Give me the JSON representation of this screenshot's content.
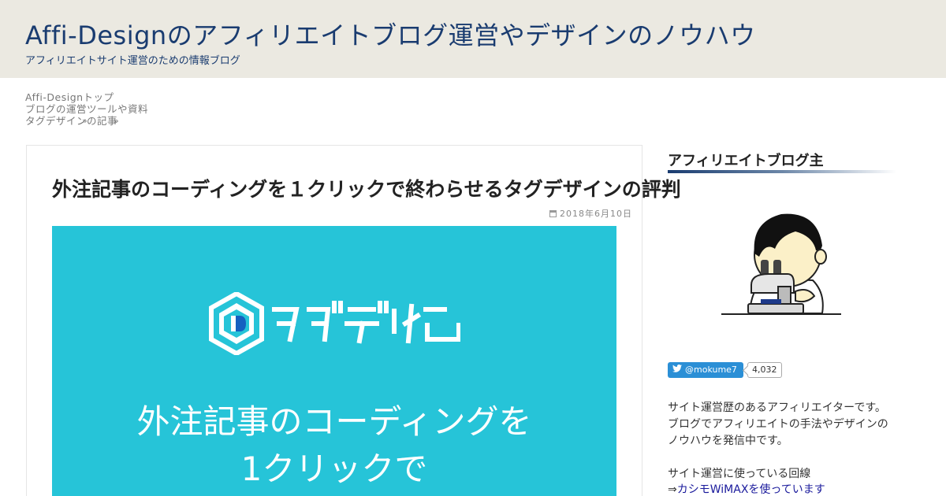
{
  "header": {
    "site_title": "Affi-Designのアフィリエイトブログ運営やデザインのノウハウ",
    "site_description": "アフィリエイトサイト運営のための情報ブログ"
  },
  "breadcrumb": {
    "items": [
      "Affi-Designトップ",
      "ブログの運営ツールや資料",
      "タグデザインの記事"
    ],
    "separators": [
      "»",
      "»"
    ]
  },
  "article": {
    "title": "外注記事のコーディングを１クリックで終わらせるタグデザインの評判",
    "date": "2018年6月10日",
    "date_icon": "calendar-icon",
    "eyecatch": {
      "logo_text": "タグデザイン",
      "line1": "外注記事のコーディングを",
      "line2": "1クリックで",
      "background": "#26c4d8"
    }
  },
  "sidebar": {
    "widget_title": "アフィリエイトブログ主",
    "avatar_icon": "researcher-microscope-icon",
    "twitter": {
      "handle": "@mokume7",
      "followers": "4,032",
      "icon": "twitter-bird-icon"
    },
    "profile_text": "サイト運営歴のあるアフィリエイターです。ブログでアフィリエイトの手法やデザインのノウハウを発信中です。",
    "profile_sub": "サイト運営に使っている回線",
    "profile_link_prefix": "⇒",
    "profile_link_text": "カシモWiMAXを使っています"
  },
  "colors": {
    "header_bg": "#ebe9e1",
    "brand": "#1a3c70",
    "eyecatch_bg": "#26c4d8",
    "twitter": "#2b8fd6"
  }
}
